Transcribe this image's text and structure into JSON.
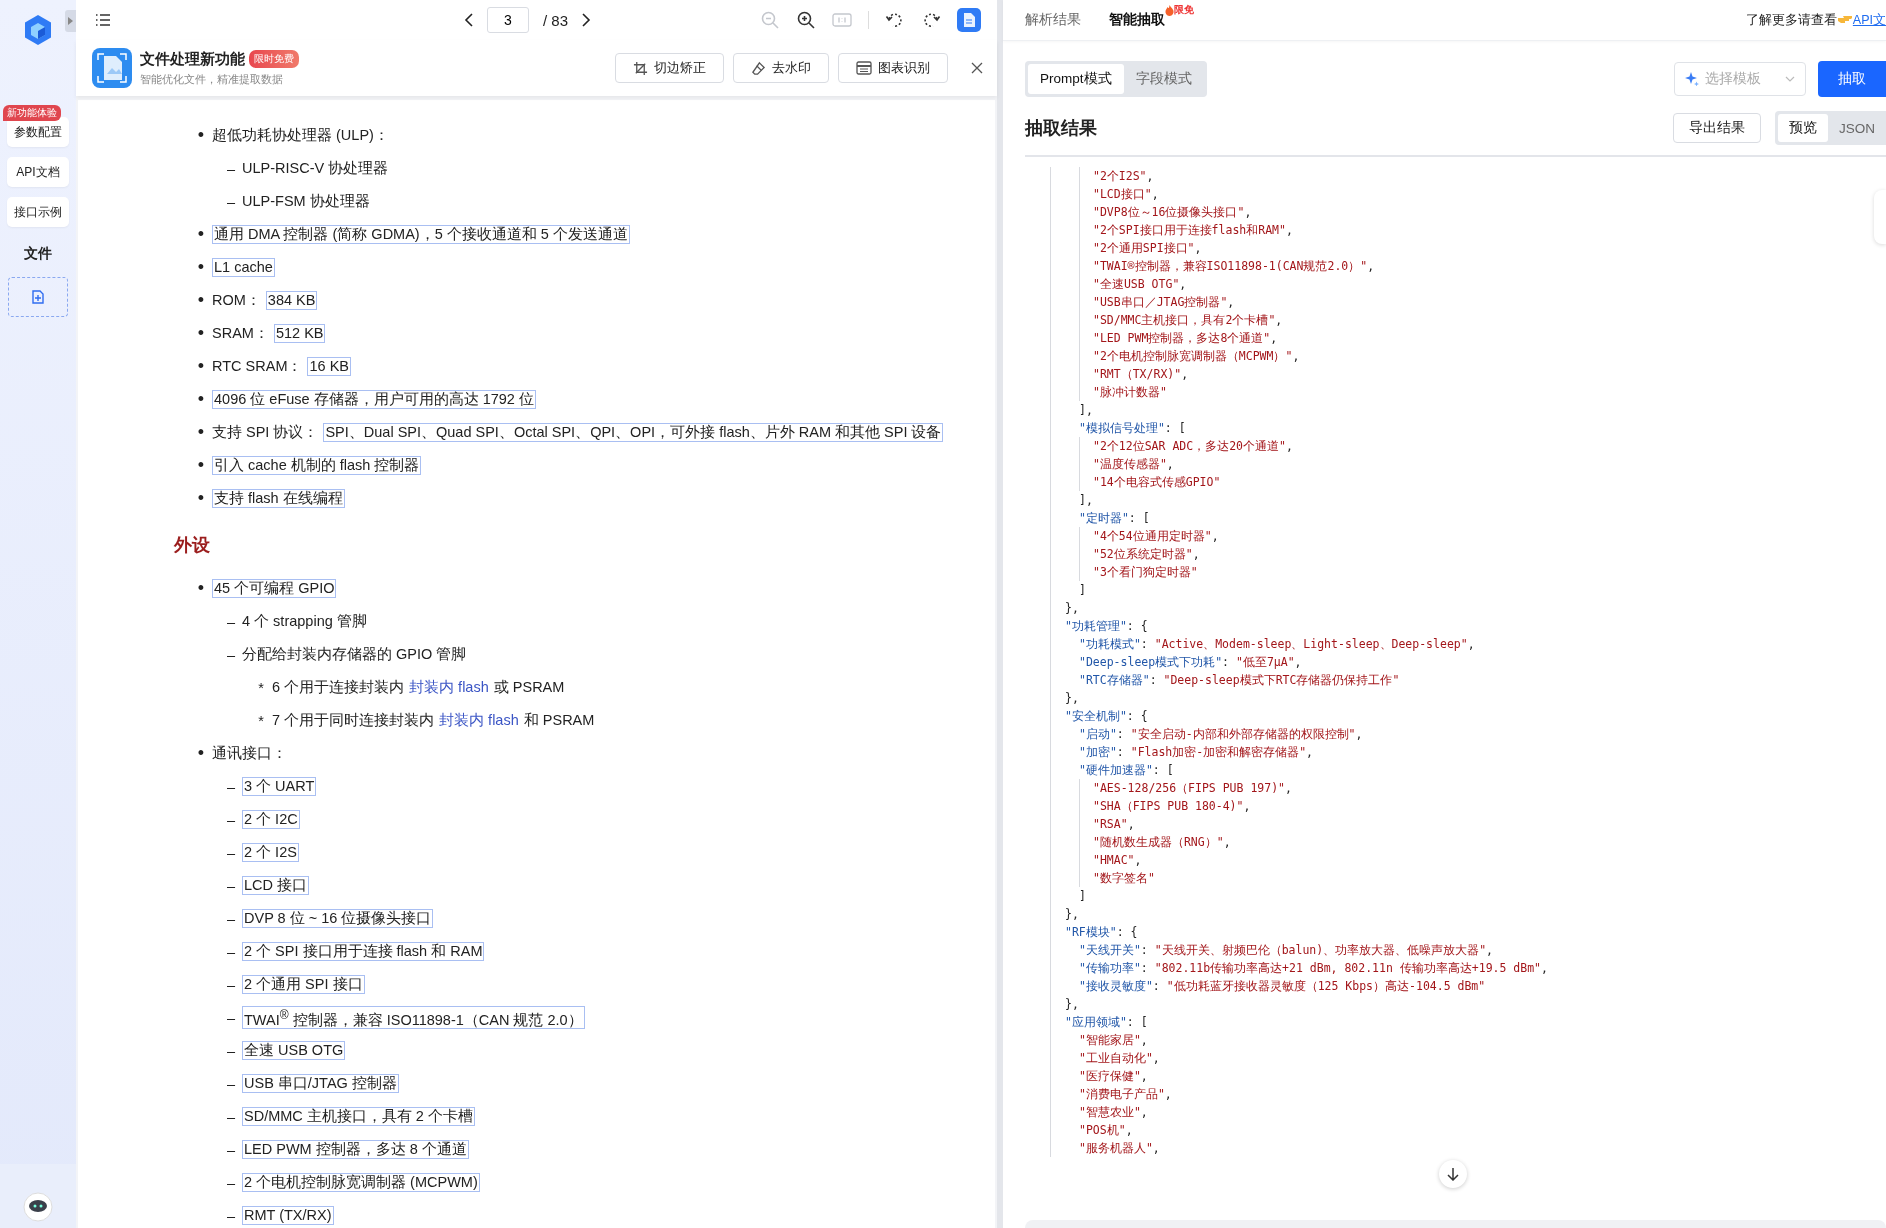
{
  "sidebar": {
    "badge": "新功能体验",
    "buttons": [
      {
        "label": "参数配置"
      },
      {
        "label": "API文档"
      },
      {
        "label": "接口示例"
      }
    ],
    "section_label": "文件"
  },
  "viewer_toolbar": {
    "page": "3",
    "page_total": "/ 83",
    "tools": [
      {
        "kind": "zoom-out",
        "disabled": true
      },
      {
        "kind": "zoom-in",
        "disabled": false
      },
      {
        "kind": "actual-size",
        "disabled": true
      },
      {
        "kind": "rotate-left",
        "disabled": false
      },
      {
        "kind": "rotate-right",
        "disabled": false
      },
      {
        "kind": "file",
        "disabled": false
      }
    ]
  },
  "banner": {
    "title": "文件处理新功能",
    "badge": "限时免费",
    "subtitle": "智能优化文件，精准提取数据",
    "buttons": [
      {
        "kind": "crop",
        "label": "切边矫正"
      },
      {
        "kind": "watermark",
        "label": "去水印"
      },
      {
        "kind": "chart",
        "label": "图表识别"
      }
    ]
  },
  "document": {
    "blocks": [
      {
        "kind": "list",
        "items": [
          {
            "marker": "•",
            "parts": [
              {
                "kind": "plain",
                "text": "超低功耗协处理器 (ULP)："
              }
            ],
            "children": [
              {
                "marker": "–",
                "parts": [
                  {
                    "kind": "plain",
                    "text": "ULP-RISC-V 协处理器"
                  }
                ]
              },
              {
                "marker": "–",
                "parts": [
                  {
                    "kind": "plain",
                    "text": "ULP-FSM 协处理器"
                  }
                ]
              }
            ]
          },
          {
            "marker": "•",
            "parts": [
              {
                "kind": "highlight",
                "text": "通用 DMA 控制器 (简称 GDMA)，5 个接收通道和 5 个发送通道"
              }
            ]
          },
          {
            "marker": "•",
            "parts": [
              {
                "kind": "highlight",
                "text": "L1 cache"
              }
            ]
          },
          {
            "marker": "•",
            "parts": [
              {
                "kind": "plain",
                "text": "ROM："
              },
              {
                "kind": "highlight",
                "text": "384 KB"
              }
            ]
          },
          {
            "marker": "•",
            "parts": [
              {
                "kind": "plain",
                "text": "SRAM："
              },
              {
                "kind": "highlight",
                "text": "512 KB"
              }
            ]
          },
          {
            "marker": "•",
            "parts": [
              {
                "kind": "plain",
                "text": "RTC SRAM："
              },
              {
                "kind": "highlight",
                "text": "16 KB"
              }
            ]
          },
          {
            "marker": "•",
            "parts": [
              {
                "kind": "highlight",
                "text": "4096 位 eFuse 存储器，用户可用的高达 1792 位"
              }
            ]
          },
          {
            "marker": "•",
            "parts": [
              {
                "kind": "plain",
                "text": "支持 SPI 协议："
              },
              {
                "kind": "highlight",
                "text": "SPI、Dual SPI、Quad SPI、Octal SPI、QPI、OPI，可外接 flash、片外 RAM 和其他 SPI 设备"
              }
            ]
          },
          {
            "marker": "•",
            "parts": [
              {
                "kind": "highlight",
                "text": "引入 cache 机制的 flash 控制器"
              }
            ]
          },
          {
            "marker": "•",
            "parts": [
              {
                "kind": "highlight",
                "text": "支持 flash 在线编程"
              }
            ]
          }
        ]
      },
      {
        "kind": "heading",
        "text": "外设"
      },
      {
        "kind": "list",
        "items": [
          {
            "marker": "•",
            "parts": [
              {
                "kind": "highlight",
                "text": "45 个可编程 GPIO"
              }
            ],
            "children": [
              {
                "marker": "–",
                "parts": [
                  {
                    "kind": "plain",
                    "text": "4 个 strapping 管脚"
                  }
                ]
              },
              {
                "marker": "–",
                "parts": [
                  {
                    "kind": "plain",
                    "text": "分配给封装内存储器的 GPIO 管脚"
                  }
                ],
                "children": [
                  {
                    "marker": "*",
                    "parts": [
                      {
                        "kind": "plain",
                        "text": "6 个用于连接封装内"
                      },
                      {
                        "kind": "link",
                        "text": "封装内 flash"
                      },
                      {
                        "kind": "plain",
                        "text": "或 PSRAM"
                      }
                    ]
                  },
                  {
                    "marker": "*",
                    "parts": [
                      {
                        "kind": "plain",
                        "text": "7 个用于同时连接封装内"
                      },
                      {
                        "kind": "link",
                        "text": "封装内 flash"
                      },
                      {
                        "kind": "plain",
                        "text": "和 PSRAM"
                      }
                    ]
                  }
                ]
              }
            ]
          },
          {
            "marker": "•",
            "parts": [
              {
                "kind": "plain",
                "text": "通讯接口："
              }
            ],
            "children": [
              {
                "marker": "–",
                "parts": [
                  {
                    "kind": "highlight",
                    "text": "3 个 UART"
                  }
                ]
              },
              {
                "marker": "–",
                "parts": [
                  {
                    "kind": "highlight",
                    "text": "2 个 I2C"
                  }
                ]
              },
              {
                "marker": "–",
                "parts": [
                  {
                    "kind": "highlight",
                    "text": "2 个 I2S"
                  }
                ]
              },
              {
                "marker": "–",
                "parts": [
                  {
                    "kind": "highlight",
                    "text": "LCD 接口"
                  }
                ]
              },
              {
                "marker": "–",
                "parts": [
                  {
                    "kind": "highlight",
                    "text": "DVP 8 位 ~ 16 位摄像头接口"
                  }
                ]
              },
              {
                "marker": "–",
                "parts": [
                  {
                    "kind": "highlight",
                    "text": "2 个 SPI 接口用于连接 flash 和 RAM"
                  }
                ]
              },
              {
                "marker": "–",
                "parts": [
                  {
                    "kind": "highlight",
                    "text": "2 个通用 SPI 接口"
                  }
                ]
              },
              {
                "marker": "–",
                "parts": [
                  {
                    "kind": "highlight",
                    "text": "TWAI$^{®}$ 控制器，兼容 ISO11898-1（CAN 规范 2.0）"
                  }
                ]
              },
              {
                "marker": "–",
                "parts": [
                  {
                    "kind": "highlight",
                    "text": "全速 USB OTG"
                  }
                ]
              },
              {
                "marker": "–",
                "parts": [
                  {
                    "kind": "highlight",
                    "text": "USB 串口/JTAG 控制器"
                  }
                ]
              },
              {
                "marker": "–",
                "parts": [
                  {
                    "kind": "highlight",
                    "text": "SD/MMC 主机接口，具有 2 个卡槽"
                  }
                ]
              },
              {
                "marker": "–",
                "parts": [
                  {
                    "kind": "highlight",
                    "text": "LED PWM 控制器，多达 8 个通道"
                  }
                ]
              },
              {
                "marker": "–",
                "parts": [
                  {
                    "kind": "highlight",
                    "text": "2 个电机控制脉宽调制器 (MCPWM)"
                  }
                ]
              },
              {
                "marker": "–",
                "parts": [
                  {
                    "kind": "highlight",
                    "text": "RMT (TX/RX)"
                  }
                ]
              }
            ]
          }
        ]
      }
    ]
  },
  "result_panel": {
    "tabs": [
      {
        "label": "解析结果",
        "selected": false
      },
      {
        "label": "智能抽取",
        "selected": true,
        "badge": "限免"
      }
    ],
    "help_text": "了解更多请查看",
    "help_link": "API文",
    "modes": [
      {
        "label": "Prompt模式",
        "selected": true
      },
      {
        "label": "字段模式",
        "selected": false
      }
    ],
    "template_select": {
      "placeholder": "选择模板"
    },
    "extract_button": "抽取",
    "heading": "抽取结果",
    "export_button": "导出结果",
    "views": [
      {
        "label": "预览",
        "selected": true
      },
      {
        "label": "JSON",
        "selected": false
      }
    ],
    "code_lines": [
      {
        "children": [
          {
            "children": [
              {
                "value": "\"2个I2S\"",
                "end": ","
              },
              {
                "value": "\"LCD接口\"",
                "end": ","
              },
              {
                "value": "\"DVP8位～16位摄像头接口\"",
                "end": ","
              },
              {
                "value": "\"2个SPI接口用于连接flash和RAM\"",
                "end": ","
              },
              {
                "value": "\"2个通用SPI接口\"",
                "end": ","
              },
              {
                "value": "\"TWAI®控制器，兼容ISO11898-1(CAN规范2.0）\"",
                "end": ","
              },
              {
                "value": "\"全速USB OTG\"",
                "end": ","
              },
              {
                "value": "\"USB串口／JTAG控制器\"",
                "end": ","
              },
              {
                "value": "\"SD/MMC主机接口，具有2个卡槽\"",
                "end": ","
              },
              {
                "value": "\"LED PWM控制器，多达8个通道\"",
                "end": ","
              },
              {
                "value": "\"2个电机控制脉宽调制器（MCPWM）\"",
                "end": ","
              },
              {
                "value": "\"RMT（TX/RX)\"",
                "end": ","
              },
              {
                "value": "\"脉冲计数器\""
              }
            ],
            "close": "],"
          },
          {
            "key": "\"模拟信号处理\"",
            "sep": ": [",
            "children": [
              {
                "value": "\"2个12位SAR ADC，多达20个通道\"",
                "end": ","
              },
              {
                "value": "\"温度传感器\"",
                "end": ","
              },
              {
                "value": "\"14个电容式传感GPIO\""
              }
            ],
            "close": "],"
          },
          {
            "key": "\"定时器\"",
            "sep": ": [",
            "children": [
              {
                "value": "\"4个54位通用定时器\"",
                "end": ","
              },
              {
                "value": "\"52位系统定时器\"",
                "end": ","
              },
              {
                "value": "\"3个看门狗定时器\""
              }
            ],
            "close": "]"
          }
        ],
        "close": "},"
      },
      {
        "key": "\"功耗管理\"",
        "sep": ": {",
        "children": [
          {
            "key": "\"功耗模式\"",
            "sep": ": ",
            "value": "\"Active、Modem-sleep、Light-sleep、Deep-sleep\"",
            "end": ","
          },
          {
            "key": "\"Deep-sleep模式下功耗\"",
            "sep": ": ",
            "value": "\"低至7μA\"",
            "end": ","
          },
          {
            "key": "\"RTC存储器\"",
            "sep": ": ",
            "value": "\"Deep-sleep模式下RTC存储器仍保持工作\""
          }
        ],
        "close": "},"
      },
      {
        "key": "\"安全机制\"",
        "sep": ": {",
        "children": [
          {
            "key": "\"启动\"",
            "sep": ": ",
            "value": "\"安全启动-内部和外部存储器的权限控制\"",
            "end": ","
          },
          {
            "key": "\"加密\"",
            "sep": ": ",
            "value": "\"Flash加密-加密和解密存储器\"",
            "end": ","
          },
          {
            "key": "\"硬件加速器\"",
            "sep": ": [",
            "children": [
              {
                "value": "\"AES-128/256（FIPS PUB 197)\"",
                "end": ","
              },
              {
                "value": "\"SHA（FIPS PUB 180-4)\"",
                "end": ","
              },
              {
                "value": "\"RSA\"",
                "end": ","
              },
              {
                "value": "\"随机数生成器（RNG）\"",
                "end": ","
              },
              {
                "value": "\"HMAC\"",
                "end": ","
              },
              {
                "value": "\"数字签名\""
              }
            ],
            "close": "]"
          }
        ],
        "close": "},"
      },
      {
        "key": "\"RF模块\"",
        "sep": ": {",
        "children": [
          {
            "key": "\"天线开关\"",
            "sep": ": ",
            "value": "\"天线开关、射频巴伦（balun)、功率放大器、低噪声放大器\"",
            "end": ","
          },
          {
            "key": "\"传输功率\"",
            "sep": ": ",
            "value": "\"802.11b传输功率高达+21 dBm, 802.11n 传输功率高达+19.5 dBm\"",
            "end": ","
          },
          {
            "key": "\"接收灵敏度\"",
            "sep": ": ",
            "value": "\"低功耗蓝牙接收器灵敏度（125 Kbps）高达-104.5 dBm\""
          }
        ],
        "close": "},"
      },
      {
        "key": "\"应用领域\"",
        "sep": ": [",
        "children": [
          {
            "value": "\"智能家居\"",
            "end": ","
          },
          {
            "value": "\"工业自动化\"",
            "end": ","
          },
          {
            "value": "\"医疗保健\"",
            "end": ","
          },
          {
            "value": "\"消费电子产品\"",
            "end": ","
          },
          {
            "value": "\"智慧农业\"",
            "end": ","
          },
          {
            "value": "\"POS机\"",
            "end": ","
          },
          {
            "value": "\"服务机器人\"",
            "end": ","
          }
        ]
      }
    ]
  }
}
